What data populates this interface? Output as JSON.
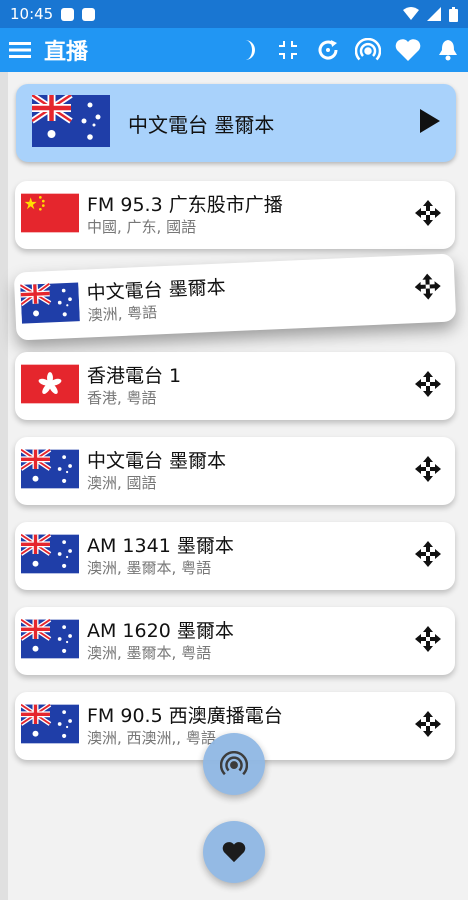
{
  "status_bar": {
    "time": "10:45"
  },
  "app_bar": {
    "title": "直播",
    "icons": [
      "menu-icon",
      "moon-icon",
      "compress-icon",
      "refresh-icon",
      "broadcast-icon",
      "heart-icon",
      "bell-icon"
    ]
  },
  "now_playing": {
    "name": "中文電台 墨爾本",
    "flag": "australia",
    "button": "play-icon"
  },
  "stations": [
    {
      "name": "FM 95.3 广东股市广播",
      "sub": "中國, 广东, 國語",
      "flag": "china"
    },
    {
      "name": "中文電台 墨爾本",
      "sub": "澳洲, 粤語",
      "flag": "australia"
    },
    {
      "name": "香港電台 1",
      "sub": "香港, 粤語",
      "flag": "hongkong"
    },
    {
      "name": "中文電台 墨爾本",
      "sub": "澳洲, 國語",
      "flag": "australia"
    },
    {
      "name": "AM 1341 墨爾本",
      "sub": "澳洲, 墨爾本, 粤語",
      "flag": "australia"
    },
    {
      "name": "AM 1620 墨爾本",
      "sub": "澳洲, 墨爾本, 粤語",
      "flag": "australia"
    },
    {
      "name": "FM 90.5 西澳廣播電台",
      "sub": "澳洲, 西澳洲,, 粤語",
      "flag": "australia"
    }
  ],
  "fabs": [
    "broadcast-icon",
    "heart-icon"
  ],
  "colors": {
    "appbar": "#2196f3",
    "status": "#1976d2",
    "now_playing_bg": "#a9d2fb",
    "fab": "#90b8e4"
  }
}
